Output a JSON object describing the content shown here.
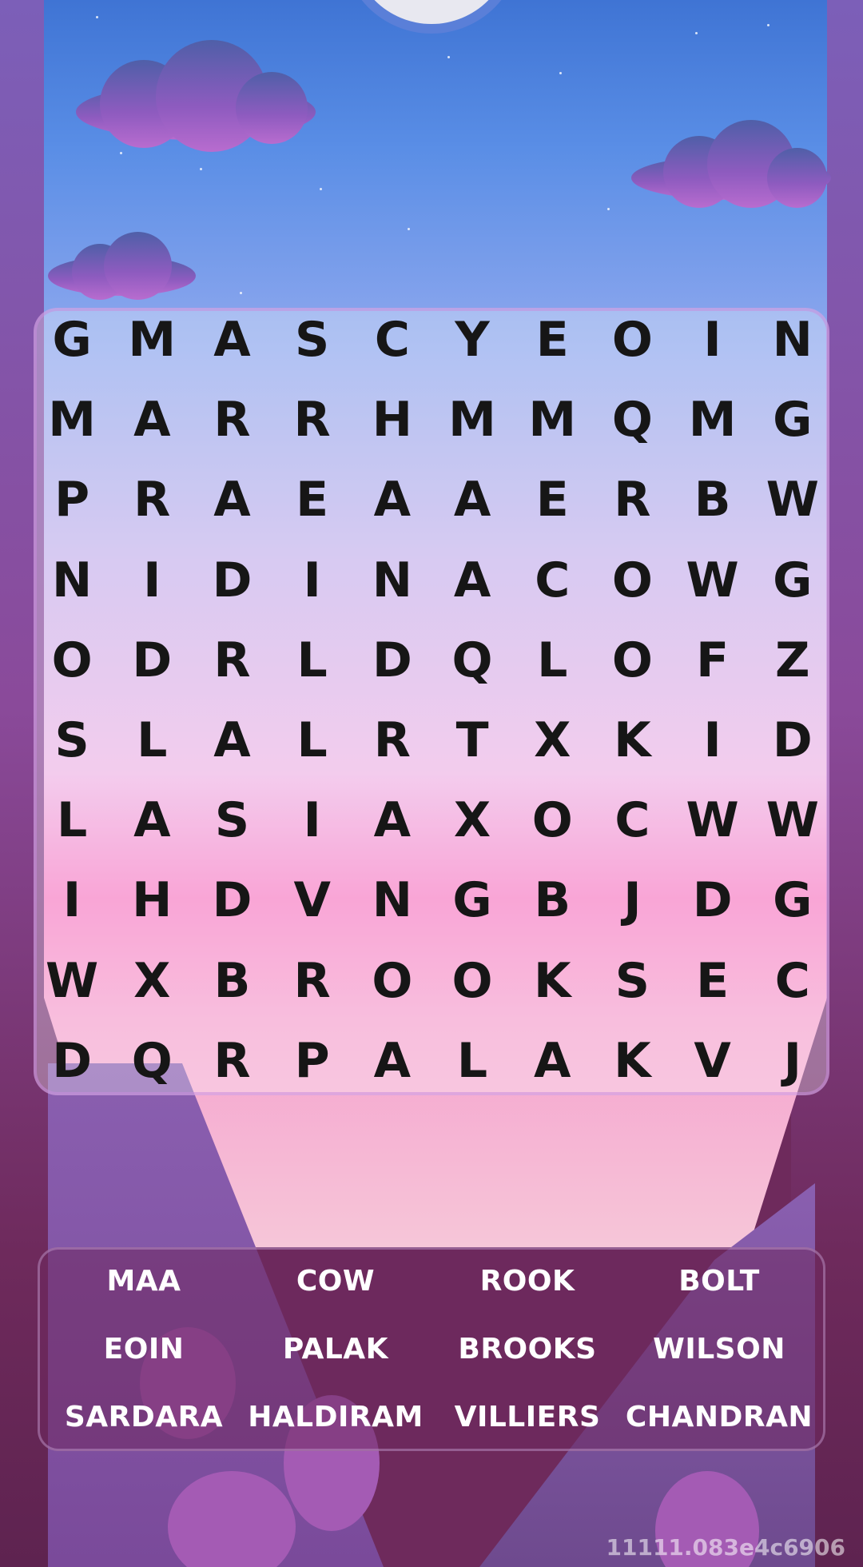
{
  "grid": {
    "rows": [
      [
        "G",
        "M",
        "A",
        "S",
        "C",
        "Y",
        "E",
        "O",
        "I",
        "N"
      ],
      [
        "M",
        "A",
        "R",
        "R",
        "H",
        "M",
        "M",
        "Q",
        "M",
        "G"
      ],
      [
        "P",
        "R",
        "A",
        "E",
        "A",
        "A",
        "E",
        "R",
        "B",
        "W"
      ],
      [
        "N",
        "I",
        "D",
        "I",
        "N",
        "A",
        "C",
        "O",
        "W",
        "G"
      ],
      [
        "O",
        "D",
        "R",
        "L",
        "D",
        "Q",
        "L",
        "O",
        "F",
        "Z"
      ],
      [
        "S",
        "L",
        "A",
        "L",
        "R",
        "T",
        "X",
        "K",
        "I",
        "D"
      ],
      [
        "L",
        "A",
        "S",
        "I",
        "A",
        "X",
        "O",
        "C",
        "W",
        "W"
      ],
      [
        "I",
        "H",
        "D",
        "V",
        "N",
        "G",
        "B",
        "J",
        "D",
        "G"
      ],
      [
        "W",
        "X",
        "B",
        "R",
        "O",
        "O",
        "K",
        "S",
        "E",
        "C"
      ],
      [
        "D",
        "Q",
        "R",
        "P",
        "A",
        "L",
        "A",
        "K",
        "V",
        "J"
      ]
    ]
  },
  "words": [
    "MAA",
    "COW",
    "ROOK",
    "BOLT",
    "EOIN",
    "PALAK",
    "BROOKS",
    "WILSON",
    "SARDARA",
    "HALDIRAM",
    "VILLIERS",
    "CHANDRAN"
  ],
  "version": "11111.083e4c6906",
  "colors": {
    "sky_top": "#3f74d4",
    "sky_bottom": "#f77fc5",
    "letter": "#161616",
    "word_text": "#ffffff"
  }
}
